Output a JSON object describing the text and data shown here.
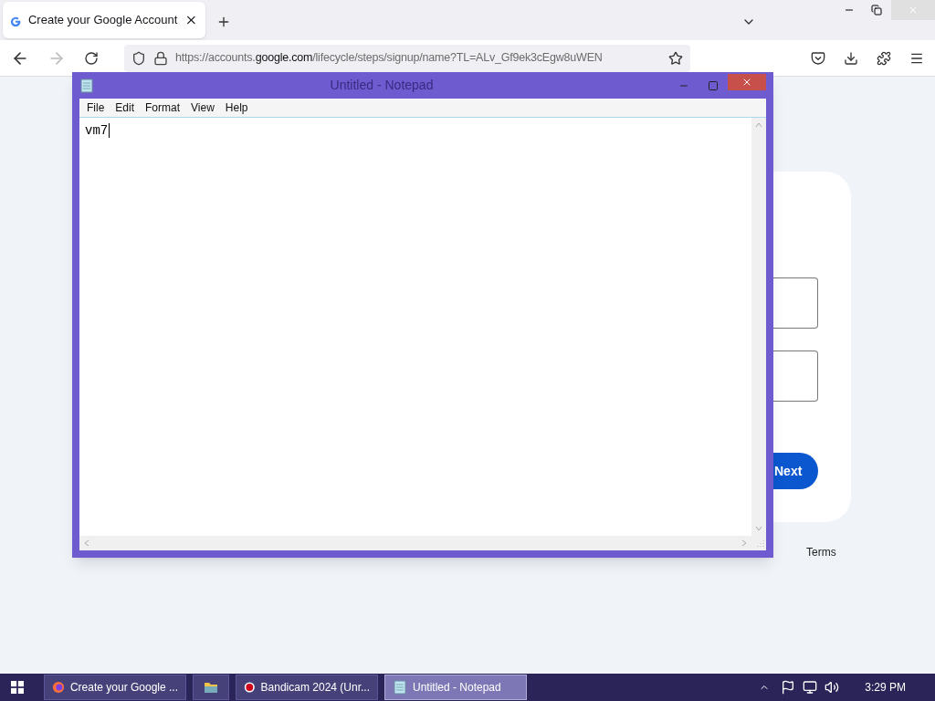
{
  "browser": {
    "tabs": [
      {
        "title": "Create your Google Account",
        "selected": true
      }
    ],
    "url": {
      "prefix": "https://accounts.",
      "domain": "google.com",
      "path": "/lifecycle/steps/signup/name?TL=ALv_Gf9ek3cEgw8uWEN"
    }
  },
  "page": {
    "next_button": "Next",
    "footer_links": [
      "Terms"
    ]
  },
  "notepad": {
    "title": "Untitled - Notepad",
    "menu": [
      "File",
      "Edit",
      "Format",
      "View",
      "Help"
    ],
    "text": "vm7"
  },
  "taskbar": {
    "items": [
      {
        "label": "Create your Google ...",
        "kind": "browser",
        "selected": false
      },
      {
        "kind": "folder",
        "selected": false
      },
      {
        "label": "Bandicam 2024 (Unr...",
        "kind": "record",
        "selected": false
      },
      {
        "label": "Untitled - Notepad",
        "kind": "notepad",
        "selected": true
      }
    ],
    "time": "3:29 PM"
  }
}
